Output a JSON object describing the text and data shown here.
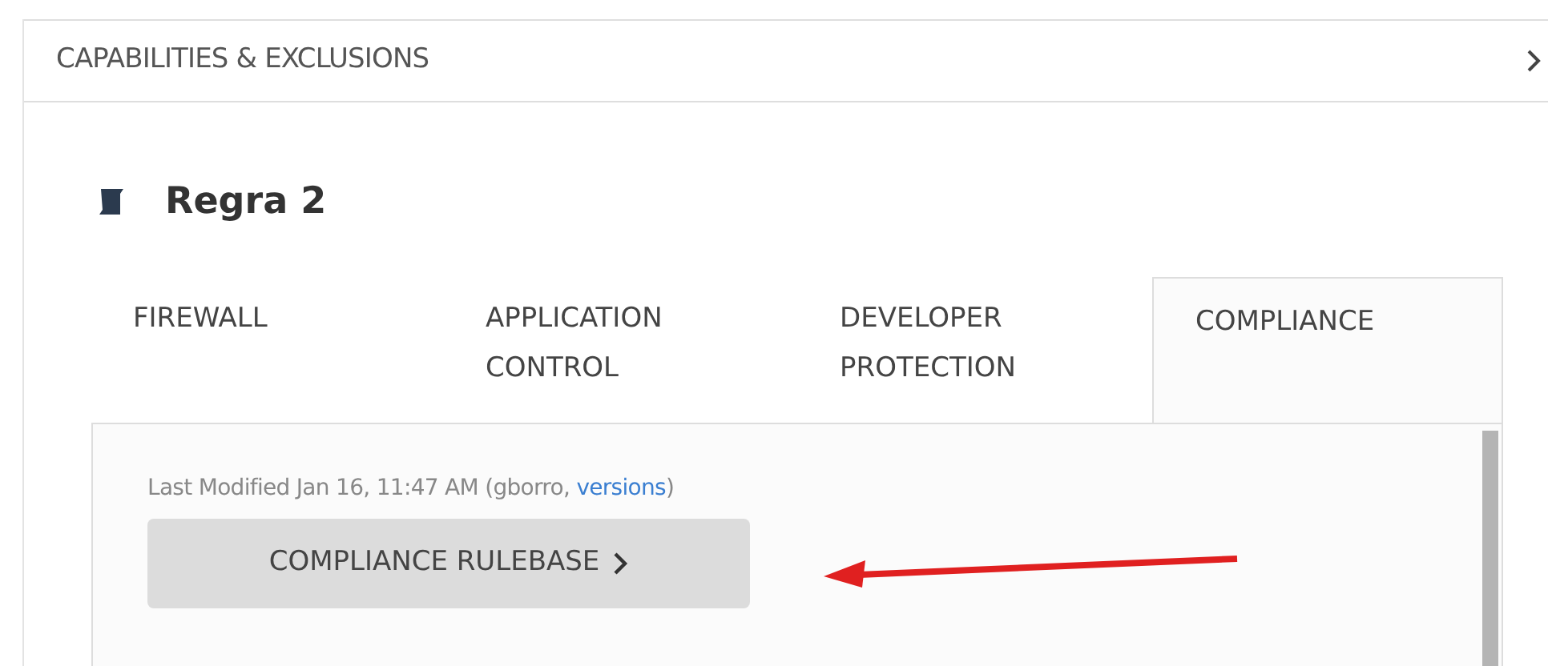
{
  "section_header": {
    "title": "CAPABILITIES & EXCLUSIONS"
  },
  "rule": {
    "title": "Regra 2"
  },
  "tabs": [
    {
      "label": "FIREWALL",
      "selected": false
    },
    {
      "label": "APPLICATION CONTROL",
      "selected": false
    },
    {
      "label": "DEVELOPER PROTECTION",
      "selected": false
    },
    {
      "label": "COMPLIANCE",
      "selected": true
    }
  ],
  "panel": {
    "last_modified": "Last Modified Jan 16, 11:47 AM (gborro, ",
    "link": "versions",
    "after_link": ")",
    "button": "COMPLIANCE RULEBASE"
  }
}
